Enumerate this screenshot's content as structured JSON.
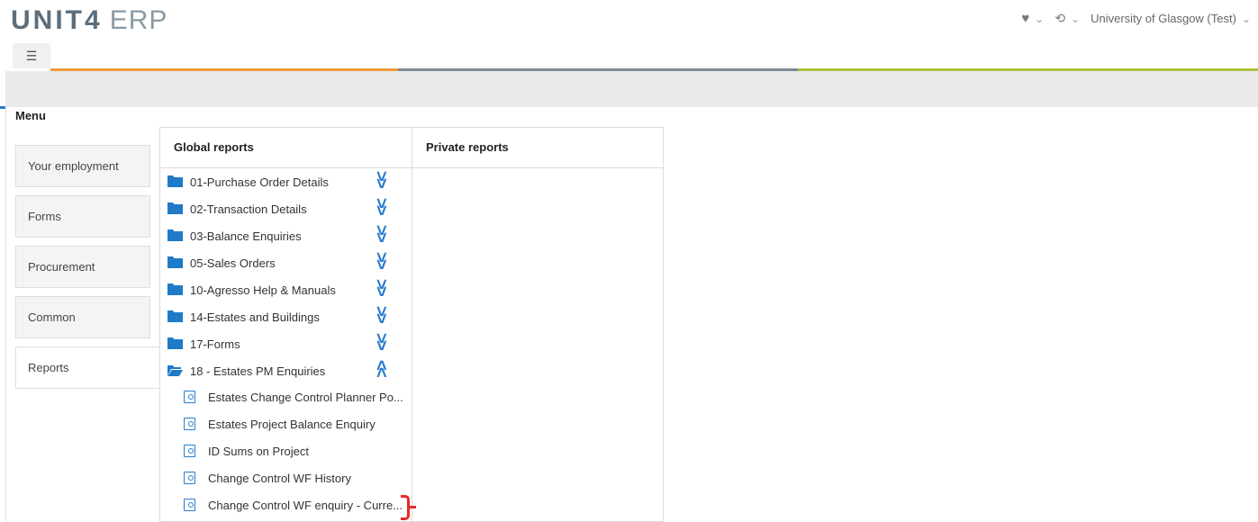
{
  "app": {
    "logo_brand": "UNIT4",
    "logo_product": "ERP",
    "org_name": "University of Glasgow (Test)"
  },
  "toolbar": {
    "favorites_icon": "heart-icon",
    "history_icon": "history-icon",
    "menu_icon": "list-menu-icon"
  },
  "colors": {
    "accent_orange": "#ef9a3d",
    "accent_gray": "#7d8a94",
    "accent_green": "#a9c23f",
    "accent_blue": "#2a7ccd"
  },
  "menu": {
    "title": "Menu",
    "tabs": [
      {
        "label": "Your employment",
        "active": false
      },
      {
        "label": "Forms",
        "active": false
      },
      {
        "label": "Procurement",
        "active": false
      },
      {
        "label": "Common",
        "active": false
      },
      {
        "label": "Reports",
        "active": true
      }
    ]
  },
  "global_reports": {
    "title": "Global reports",
    "folders": [
      {
        "label": "01-Purchase Order Details",
        "expanded": false
      },
      {
        "label": "02-Transaction Details",
        "expanded": false
      },
      {
        "label": "03-Balance Enquiries",
        "expanded": false
      },
      {
        "label": "05-Sales Orders",
        "expanded": false
      },
      {
        "label": "10-Agresso Help & Manuals",
        "expanded": false
      },
      {
        "label": "14-Estates and Buildings",
        "expanded": false
      },
      {
        "label": "17-Forms",
        "expanded": false
      },
      {
        "label": "18 - Estates PM Enquiries",
        "expanded": true
      }
    ],
    "reports": [
      {
        "label": "Estates Change Control Planner Po..."
      },
      {
        "label": "Estates Project Balance Enquiry"
      },
      {
        "label": "ID Sums on Project"
      },
      {
        "label": "Change Control WF History"
      },
      {
        "label": "Change Control WF enquiry - Curre..."
      }
    ]
  },
  "private_reports": {
    "title": "Private reports"
  }
}
